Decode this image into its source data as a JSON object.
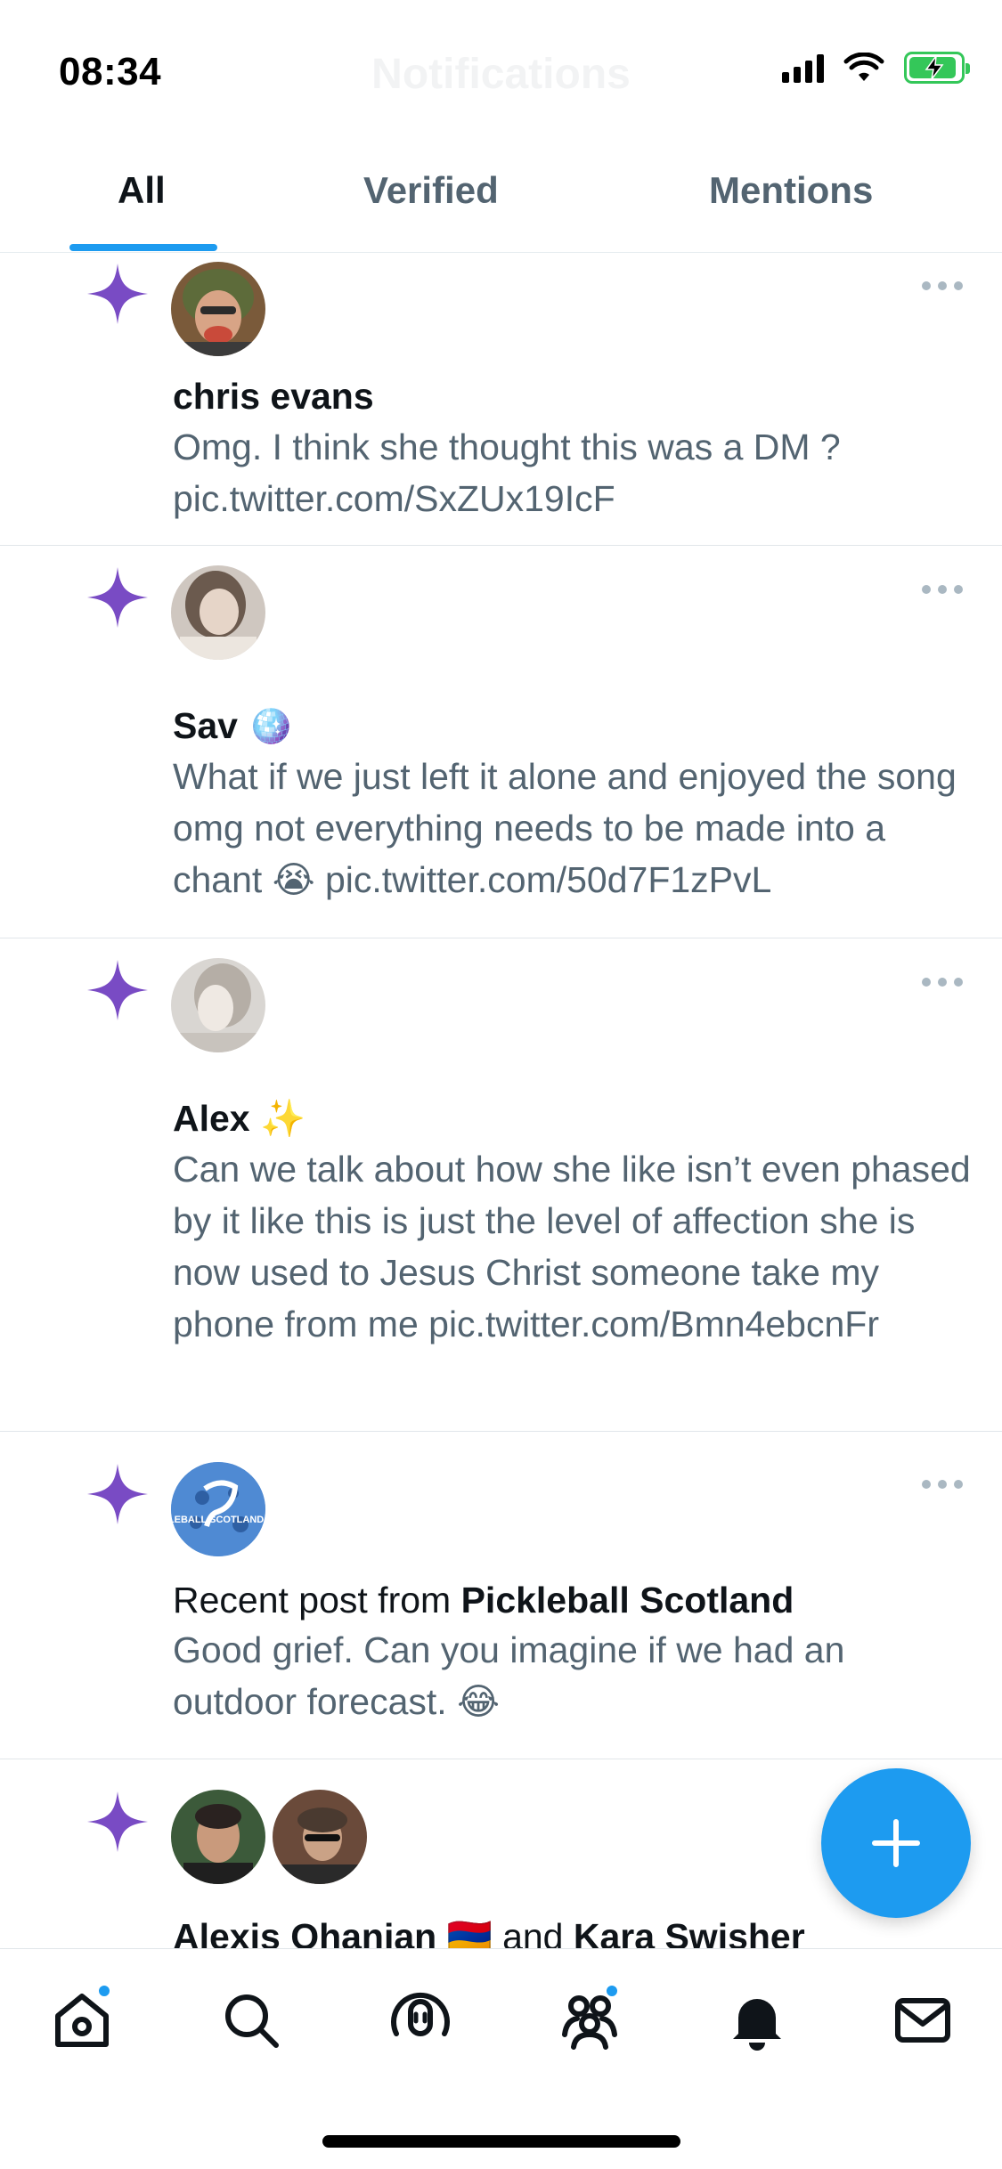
{
  "status_bar": {
    "time": "08:34",
    "battery_state": "charging"
  },
  "header": {
    "title": "Notifications"
  },
  "tabs": [
    {
      "label": "All",
      "active": true
    },
    {
      "label": "Verified",
      "active": false
    },
    {
      "label": "Mentions",
      "active": false
    }
  ],
  "notifications": [
    {
      "name": "chris evans",
      "text": "Omg. I think she thought this was a DM ? pic.twitter.com/SxZUx19IcF"
    },
    {
      "name": "Sav",
      "name_emoji": "🪩",
      "text": "What if we just left it alone and enjoyed the song omg not everything needs to be made into a chant 😭 pic.twitter.com/50d7F1zPvL"
    },
    {
      "name": "Alex",
      "name_emoji": "✨",
      "text": "Can we talk about how she like isn’t even phased by it like this is just the level of affection she is now used to Jesus Christ someone take my phone from me pic.twitter.com/Bmn4ebcnFr"
    },
    {
      "prefix": "Recent post from ",
      "name": "Pickleball Scotland",
      "text": "Good grief. Can you imagine if we had an outdoor forecast. 😂",
      "avatar_text": "PICKLEBALL SCOTLAND .ORG"
    },
    {
      "name": "Alexis Ohanian",
      "name_emoji": "🇦🇲",
      "joiner": " and ",
      "name2": "Kara Swisher"
    }
  ],
  "colors": {
    "accent": "#1d9bf0",
    "sparkle": "#794bc4",
    "secondary_text": "#536471"
  },
  "bottom_nav": [
    {
      "icon": "home-icon",
      "badge": true
    },
    {
      "icon": "search-icon",
      "badge": false
    },
    {
      "icon": "spaces-icon",
      "badge": false
    },
    {
      "icon": "communities-icon",
      "badge": true
    },
    {
      "icon": "bell-icon",
      "badge": false
    },
    {
      "icon": "mail-icon",
      "badge": false
    }
  ]
}
